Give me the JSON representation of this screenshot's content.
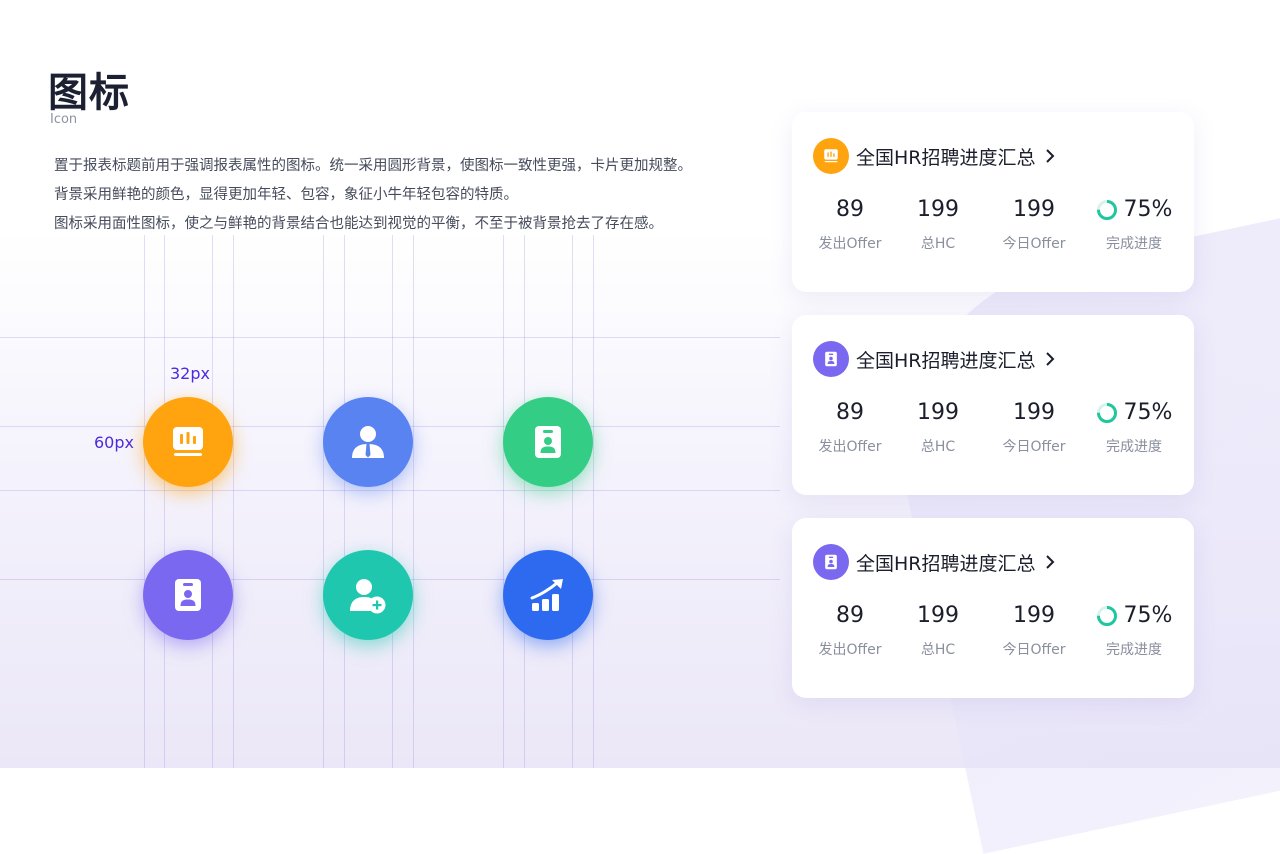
{
  "page": {
    "title": "图标",
    "subtitle": "Icon",
    "description": [
      "置于报表标题前用于强调报表属性的图标。统一采用圆形背景，使图标一致性更强，卡片更加规整。",
      "背景采用鲜艳的颜色，显得更加年轻、包容，象征小牛年轻包容的特质。",
      "图标采用面性图标，使之与鲜艳的背景结合也能达到视觉的平衡，不至于被背景抢去了存在感。"
    ]
  },
  "dimensions": {
    "icon_size": "32px",
    "circle_size": "60px"
  },
  "icons": [
    {
      "name": "chart-board-icon",
      "color": "#ffa30f"
    },
    {
      "name": "user-tie-icon",
      "color": "#5a83f2"
    },
    {
      "name": "id-badge-icon",
      "color": "#34cd85"
    },
    {
      "name": "id-badge-icon",
      "color": "#7a68f0"
    },
    {
      "name": "user-add-icon",
      "color": "#1fc7ae"
    },
    {
      "name": "growth-chart-icon",
      "color": "#2d6af0"
    }
  ],
  "cards": [
    {
      "icon": "chart-board-icon",
      "icon_color": "#ffa30f",
      "title": "全国HR招聘进度汇总",
      "stats": [
        {
          "value": "89",
          "label": "发出Offer"
        },
        {
          "value": "199",
          "label": "总HC"
        },
        {
          "value": "199",
          "label": "今日Offer"
        }
      ],
      "progress": {
        "value": "75%",
        "fraction": 0.75,
        "label": "完成进度",
        "color": "#1fc7a0"
      }
    },
    {
      "icon": "id-badge-icon",
      "icon_color": "#7a68f0",
      "title": "全国HR招聘进度汇总",
      "stats": [
        {
          "value": "89",
          "label": "发出Offer"
        },
        {
          "value": "199",
          "label": "总HC"
        },
        {
          "value": "199",
          "label": "今日Offer"
        }
      ],
      "progress": {
        "value": "75%",
        "fraction": 0.75,
        "label": "完成进度",
        "color": "#1fc7a0"
      }
    },
    {
      "icon": "id-badge-icon",
      "icon_color": "#7a68f0",
      "title": "全国HR招聘进度汇总",
      "stats": [
        {
          "value": "89",
          "label": "发出Offer"
        },
        {
          "value": "199",
          "label": "总HC"
        },
        {
          "value": "199",
          "label": "今日Offer"
        }
      ],
      "progress": {
        "value": "75%",
        "fraction": 0.75,
        "label": "完成进度",
        "color": "#1fc7a0"
      }
    }
  ]
}
